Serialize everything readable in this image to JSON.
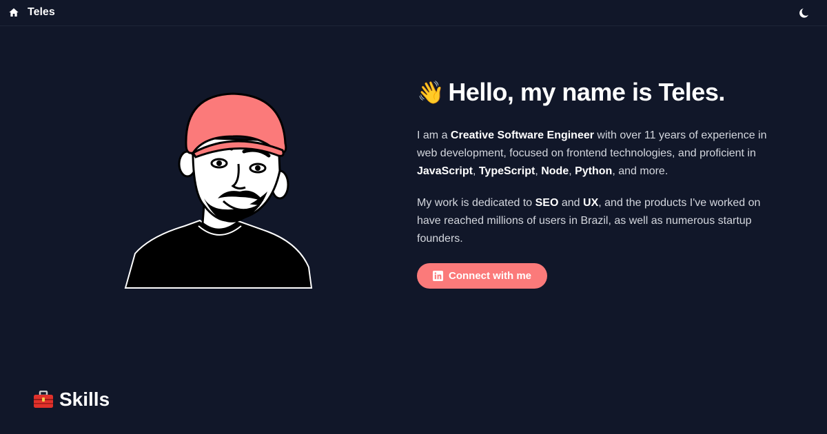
{
  "nav": {
    "brand": "Teles",
    "home_icon": "home-icon",
    "theme_icon": "moon-icon"
  },
  "hero": {
    "wave_emoji": "👋",
    "title": "Hello, my name is Teles.",
    "intro": [
      {
        "text": "I am a ",
        "bold": false
      },
      {
        "text": "Creative Software Engineer",
        "bold": true
      },
      {
        "text": " with over 11 years of experience in web development, focused on frontend technologies, and proficient in ",
        "bold": false
      },
      {
        "text": "JavaScript",
        "bold": true
      },
      {
        "text": ", ",
        "bold": false
      },
      {
        "text": "TypeScript",
        "bold": true
      },
      {
        "text": ", ",
        "bold": false
      },
      {
        "text": "Node",
        "bold": true
      },
      {
        "text": ", ",
        "bold": false
      },
      {
        "text": "Python",
        "bold": true
      },
      {
        "text": ", and more.",
        "bold": false
      }
    ],
    "work": [
      {
        "text": "My work is dedicated to ",
        "bold": false
      },
      {
        "text": "SEO",
        "bold": true
      },
      {
        "text": " and ",
        "bold": false
      },
      {
        "text": "UX",
        "bold": true
      },
      {
        "text": ", and the products I've worked on have reached millions of users in Brazil, as well as numerous startup founders.",
        "bold": false
      }
    ],
    "cta_label": "Connect with me",
    "cta_icon": "linkedin-icon"
  },
  "skills": {
    "title": "Skills",
    "icon": "toolbox-icon"
  },
  "colors": {
    "background": "#111729",
    "accent": "#fb7a7a",
    "text_muted": "#d4d7de"
  }
}
